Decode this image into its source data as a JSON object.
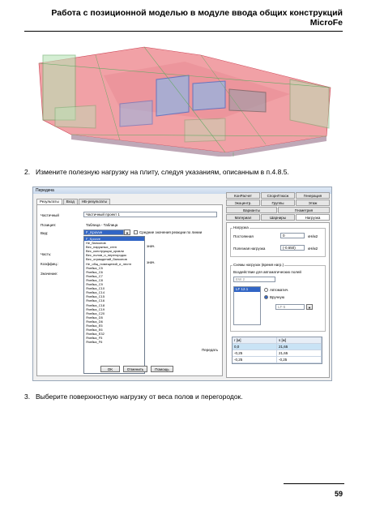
{
  "header": {
    "title": "Работа с позиционной моделью в модуле ввода общих конструкций MicroFe"
  },
  "step2": {
    "num": "2.",
    "text": "Измените полезную нагрузку на плиту, следуя указаниям, описанным в п.4.8.5."
  },
  "step3": {
    "num": "3.",
    "text": "Выберите поверхностную нагрузку от веса полов и перегородок."
  },
  "dialog": {
    "title": "Передача",
    "left_tabs": [
      "Результаты",
      "Вход",
      "НБ-результаты"
    ],
    "fields": {
      "partial_label": "Частичный",
      "partial_value": "Частичный проект 1",
      "position_label": "Позиция:",
      "position_value": "Таблица - Таблица",
      "view_label": "Вид:",
      "view_value": "F_Kpovve",
      "checkbox_label": "Средние значения реакции по линии",
      "part_label": "Часть:",
      "coef_label": "Коэффиц.:",
      "coef_suffix": "знач.",
      "znach_suffix": "знач.",
      "value_label": "Значение:"
    },
    "dropdown_items": [
      "F_Kpovve",
      "Не_балконов",
      "Вес_наружных_стен",
      "Вес_конструкции_кровли",
      "Вес_полов_и_перегородок",
      "Вес_ограждений_балконов",
      "Не_общ_помещений_и_лестн",
      "Ячейка_C5",
      "Ячейка_C6",
      "Ячейка_C7",
      "Ячейка_C8",
      "Ячейка_C9",
      "Ячейка_C10",
      "Ячейка_C14",
      "Ячейка_C15",
      "Ячейка_C16",
      "Ячейка_C18",
      "Ячейка_C19",
      "Ячейка_C20",
      "Ячейка_D5",
      "Ячейка_D6",
      "Ячейка_E5",
      "Ячейка_E6",
      "Ячейка_E32",
      "Ячейка_F5",
      "Ячейка_F6"
    ],
    "transfer_label": "Передать",
    "ok_label": "OK",
    "cancel_label": "Отменить",
    "help_label": "Помощь",
    "right_tabs_row1": [
      "КонРасчет",
      "СпорнГлюсж",
      "Генерация"
    ],
    "right_tabs_row2": [
      "Экоцентр.",
      "Группы",
      "Этаж"
    ],
    "right_tabs_row3": [
      "Варианты",
      "Геометрия"
    ],
    "right_tabs_row4": [
      "Материал",
      "Шарниры",
      "Нагрузка"
    ],
    "load_group": "Нагрузка",
    "permanent_label": "Постоянная",
    "permanent_value": "0",
    "permanent_unit": "кН/м2",
    "useful_label": "Полезная нагрузка",
    "useful_value": "(-0.650)",
    "useful_unit": "кН/м2",
    "schemes_group": "Схемы нагрузок (время нагр.)",
    "auto_label": "Воздействие для автоматических полей",
    "ew_value": "EW 2",
    "lf_selected": "LF 12.1",
    "radio_auto": "Автоматич.",
    "radio_manual": "Вручную",
    "lf_value": "LF-5",
    "grid_headers": [
      "г [м]",
      "s [м]"
    ],
    "grid_rows": [
      [
        "0,0",
        "21,65"
      ],
      [
        "-0,25",
        "21,65"
      ],
      [
        "-0,25",
        "-0,25"
      ]
    ]
  },
  "page_number": "59"
}
